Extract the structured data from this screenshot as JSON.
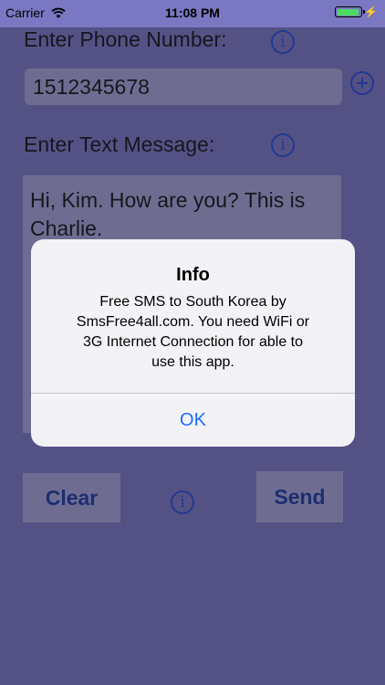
{
  "status_bar": {
    "carrier": "Carrier",
    "time": "11:08 PM",
    "bolt": "⚡"
  },
  "form": {
    "phone_label": "Enter Phone Number:",
    "phone_value": "1512345678",
    "message_label": "Enter Text Message:",
    "message_value": "Hi, Kim.  How are you?  This is Charlie."
  },
  "buttons": {
    "clear": "Clear",
    "send": "Send"
  },
  "icons": {
    "info_glyph": "i"
  },
  "alert": {
    "title": "Info",
    "message": "Free SMS to South Korea by SmsFree4all.com.  You need WiFi or 3G Internet Connection for able to use this app.",
    "ok": "OK"
  },
  "colors": {
    "background": "#7a78c2",
    "field": "#a8a6d6",
    "accent_blue": "#2a4ad6",
    "button_text": "#1a3a9e",
    "alert_action": "#1a6dfc",
    "battery": "#4cd964"
  }
}
